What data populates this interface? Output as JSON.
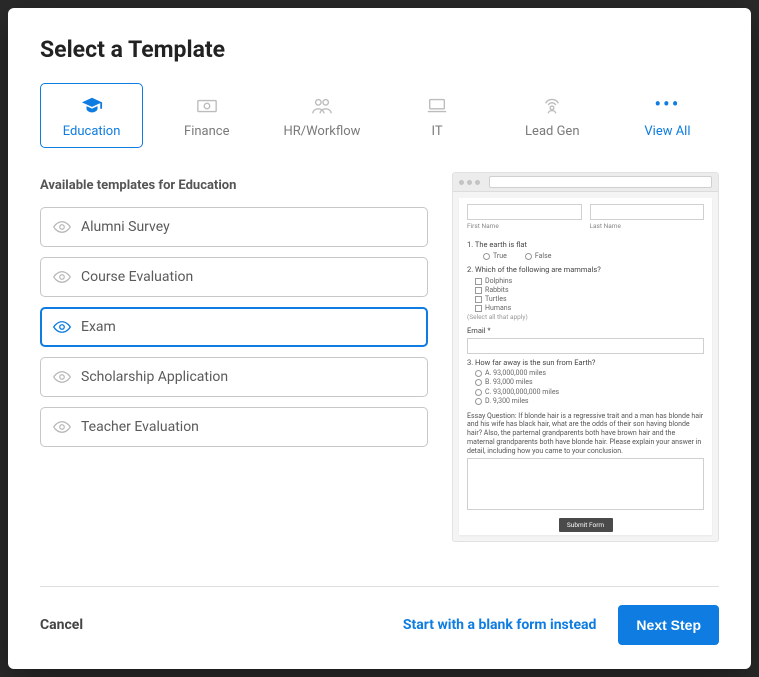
{
  "title": "Select a Template",
  "categories": [
    {
      "id": "education",
      "label": "Education",
      "icon": "graduation-cap",
      "active": true
    },
    {
      "id": "finance",
      "label": "Finance",
      "icon": "money"
    },
    {
      "id": "hr",
      "label": "HR/Workflow",
      "icon": "people"
    },
    {
      "id": "it",
      "label": "IT",
      "icon": "laptop"
    },
    {
      "id": "leadgen",
      "label": "Lead Gen",
      "icon": "broadcast"
    },
    {
      "id": "viewall",
      "label": "View All",
      "icon": "dots",
      "viewall": true
    }
  ],
  "available_heading": "Available templates for Education",
  "templates": [
    {
      "label": "Alumni Survey",
      "selected": false
    },
    {
      "label": "Course Evaluation",
      "selected": false
    },
    {
      "label": "Exam",
      "selected": true
    },
    {
      "label": "Scholarship Application",
      "selected": false
    },
    {
      "label": "Teacher Evaluation",
      "selected": false
    }
  ],
  "preview": {
    "first_name": "First Name",
    "last_name": "Last Name",
    "q1": "1. The earth is flat",
    "q1_opts": [
      "True",
      "False"
    ],
    "q2": "2. Which of the following are mammals?",
    "q2_opts": [
      "Dolphins",
      "Rabbits",
      "Turtles",
      "Humans"
    ],
    "q2_note": "(Select all that apply)",
    "email_label": "Email *",
    "q3": "3. How far away is the sun from Earth?",
    "q3_opts": [
      "A. 93,000,000 miles",
      "B. 93,000 miles",
      "C. 93,000,000,000 miles",
      "D. 9,300 miles"
    ],
    "essay": "Essay Question: If blonde hair is a regressive trait and a man has blonde hair and his wife has black hair, what are the odds of their son having blonde hair? Also, the parternal grandparents both have brown hair and the maternal grandparents both have blonde hair. Please explain your answer in detail, including how you came to your conclusion.",
    "submit": "Submit Form"
  },
  "footer": {
    "cancel": "Cancel",
    "start_blank": "Start with a blank form instead",
    "next": "Next Step"
  }
}
